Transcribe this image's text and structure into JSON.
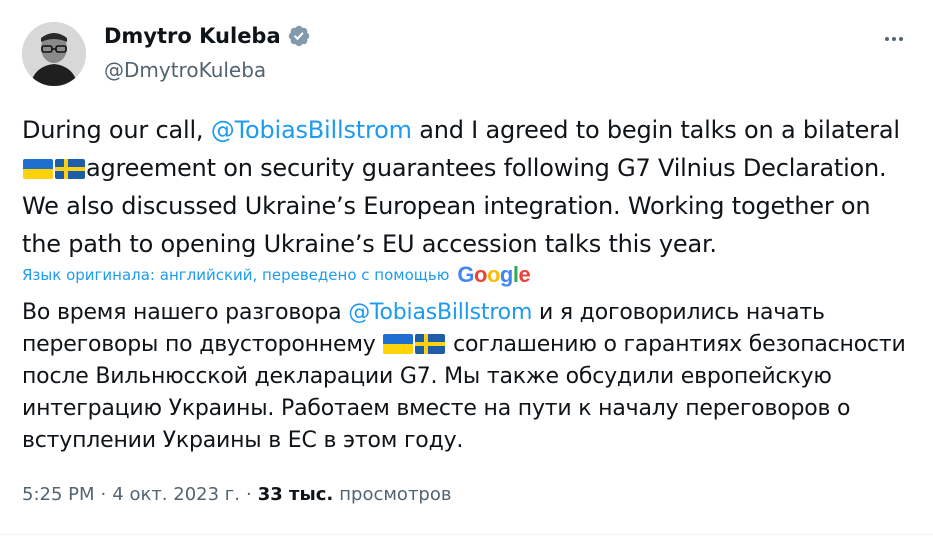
{
  "author": {
    "display_name": "Dmytro Kuleba",
    "handle": "@DmytroKuleba"
  },
  "tweet": {
    "segments": {
      "s1": "During our call, ",
      "mention": "@TobiasBillstrom",
      "s2": " and I agreed to begin talks on a bilateral ",
      "s3": "agreement on security guarantees following G7 Vilnius Declaration. We also discussed Ukraine’s European integration. Working together on the path to opening Ukraine’s EU accession talks this year."
    },
    "flags": [
      "flag-ukraine-icon",
      "flag-sweden-icon"
    ]
  },
  "translation": {
    "note": "Язык оригинала: английский, переведено с помощью",
    "provider": "Google",
    "segments": {
      "s1": "Во время нашего разговора ",
      "mention": "@TobiasBillstrom",
      "s2": " и я договорились начать переговоры по двустороннему ",
      "s3": " соглашению о гарантиях безопасности после Вильнюсской декларации G7. Мы также обсудили европейскую интеграцию Украины. Работаем вместе на пути к началу переговоров о вступлении Украины в ЕС в этом году."
    }
  },
  "meta": {
    "time": "5:25 PM",
    "sep1": "·",
    "date": "4 окт. 2023 г.",
    "sep2": "·",
    "views_count": "33 тыс.",
    "views_label": "просмотров"
  },
  "colors": {
    "link": "#1d9bf0",
    "verified": "#829aab",
    "secondary_text": "#536471"
  }
}
